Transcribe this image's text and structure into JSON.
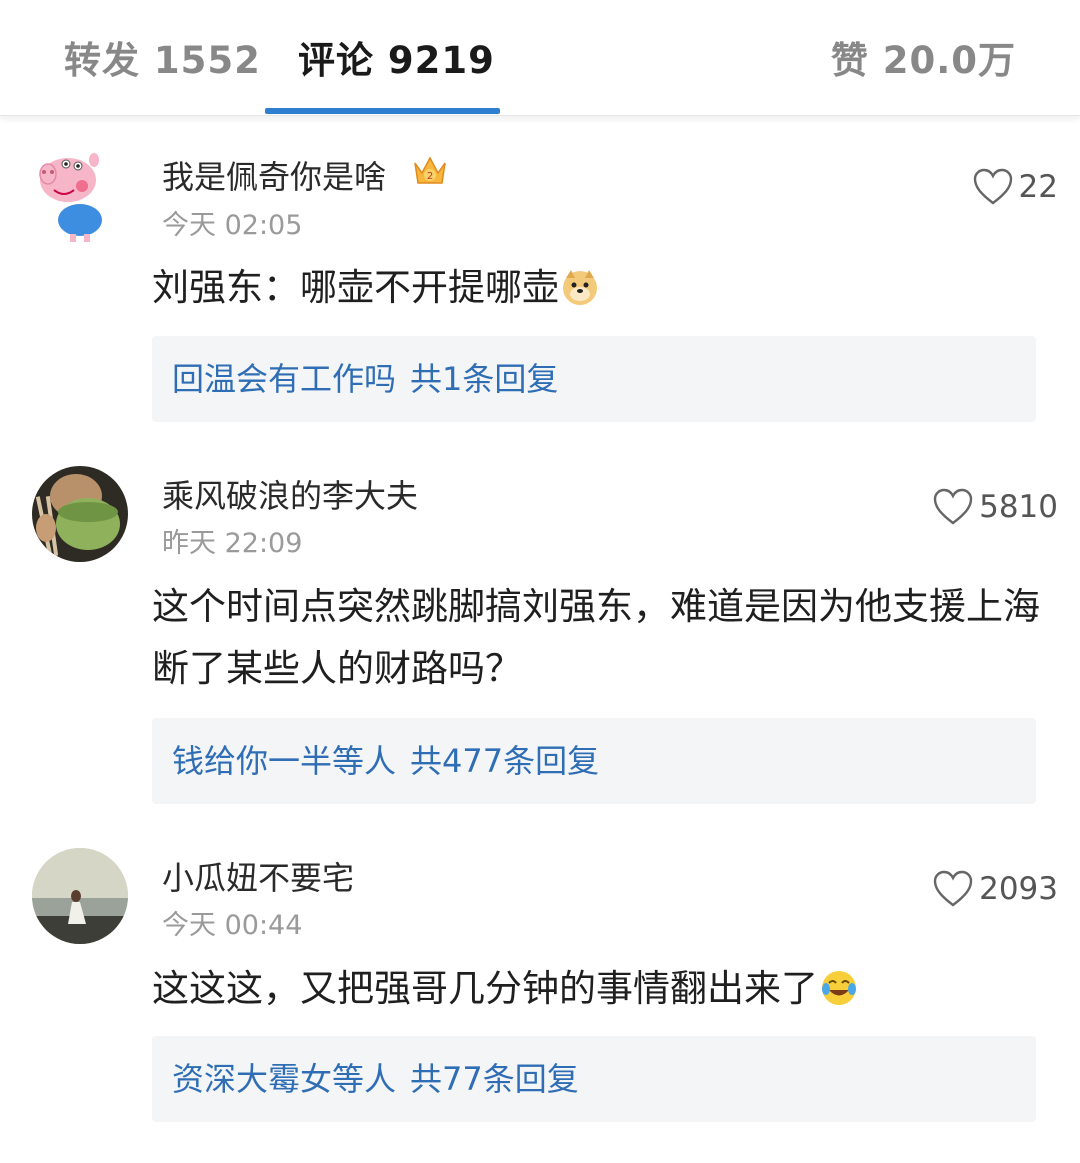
{
  "tabs": {
    "repost": "转发 1552",
    "comment": "评论 9219",
    "like": "赞 20.0万"
  },
  "comments": [
    {
      "username": "我是佩奇你是啥",
      "time": "今天 02:05",
      "likes": "22",
      "text": "刘强东：哪壶不开提哪壶",
      "reply_names": "回温会有工作吗",
      "reply_count": "共1条回复"
    },
    {
      "username": "乘风破浪的李大夫",
      "time": "昨天 22:09",
      "likes": "5810",
      "text": "这个时间点突然跳脚搞刘强东，难道是因为他支援上海断了某些人的财路吗？",
      "reply_names": "钱给你一半等人",
      "reply_count": "共477条回复"
    },
    {
      "username": "小瓜妞不要宅",
      "time": "今天 00:44",
      "likes": "2093",
      "text": "这这这，又把强哥几分钟的事情翻出来了",
      "reply_names": "资深大霉女等人",
      "reply_count": "共77条回复"
    }
  ],
  "colors": {
    "accent": "#2f7fd1",
    "reply_link": "#2f6eb5",
    "reply_bg": "#f4f5f7"
  }
}
